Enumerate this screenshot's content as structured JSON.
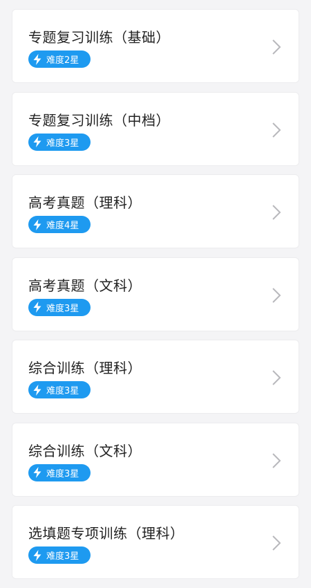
{
  "items": [
    {
      "title": "专题复习训练（基础）",
      "difficulty": "难度2星"
    },
    {
      "title": "专题复习训练（中档）",
      "difficulty": "难度3星"
    },
    {
      "title": "高考真题（理科）",
      "difficulty": "难度4星"
    },
    {
      "title": "高考真题（文科）",
      "difficulty": "难度3星"
    },
    {
      "title": "综合训练（理科）",
      "difficulty": "难度3星"
    },
    {
      "title": "综合训练（文科）",
      "difficulty": "难度3星"
    },
    {
      "title": "选填题专项训练（理科）",
      "difficulty": "难度3星"
    }
  ],
  "icons": {
    "badge": "lightning-icon",
    "arrow": "chevron-right-icon"
  },
  "colors": {
    "accent": "#1e9af0",
    "background": "#f4f4f6",
    "card": "#ffffff",
    "title_text": "#222222",
    "chevron": "#b8b8bc"
  }
}
